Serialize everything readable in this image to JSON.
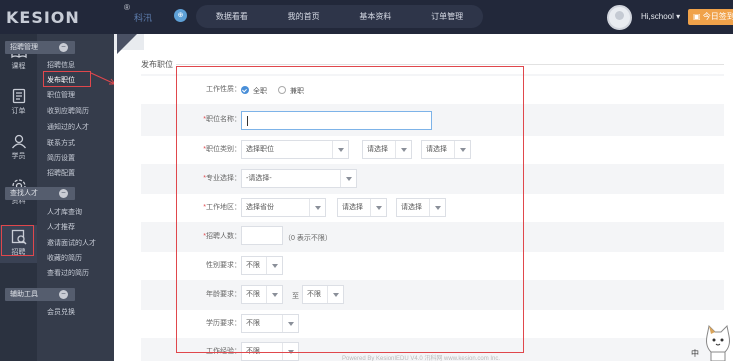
{
  "header": {
    "logo_text": "KESION",
    "logo_reg": "®",
    "logo_sub": "科汛",
    "circle_icon": "⊕",
    "nav": [
      "数据看看",
      "我的首页",
      "基本资料",
      "订单管理"
    ],
    "username": "Hi,school",
    "today_button": "今日签到"
  },
  "rail": [
    {
      "label": "课程",
      "icon": "book-icon"
    },
    {
      "label": "订单",
      "icon": "order-icon"
    },
    {
      "label": "学员",
      "icon": "user-icon"
    },
    {
      "label": "资料",
      "icon": "gear-icon"
    },
    {
      "label": "招聘",
      "icon": "recruit-icon"
    }
  ],
  "submenu": {
    "group1": {
      "title": "招聘管理",
      "items": [
        "招聘信息",
        "发布职位",
        "职位管理",
        "收到应聘简历",
        "通知过的人才",
        "联系方式",
        "简历设置",
        "招聘配置"
      ]
    },
    "group2": {
      "title": "查找人才",
      "items": [
        "人才库查询",
        "人才推荐",
        "邀请面试的人才",
        "收藏的简历",
        "查看过的简历"
      ]
    },
    "group3": {
      "title": "辅助工具",
      "items": [
        "会员兑换"
      ]
    }
  },
  "page": {
    "title": "发布职位",
    "footer": "Powered By KesionIEDU V4.0 汛科网 www.kesion.com Inc."
  },
  "form": {
    "work_type": {
      "label": "工作性质：",
      "options": [
        "全职",
        "兼职"
      ],
      "selected": "全职"
    },
    "job_name": {
      "label": "职位名称：",
      "req": "*",
      "value": ""
    },
    "job_category": {
      "label": "职位类别：",
      "req": "*",
      "values": [
        "选择职位",
        "请选择",
        "请选择"
      ]
    },
    "major": {
      "label": "专业选择：",
      "req": "*",
      "value": "-请选择-"
    },
    "work_area": {
      "label": "工作地区：",
      "req": "*",
      "values": [
        "选择省份",
        "请选择",
        "请选择"
      ]
    },
    "headcount": {
      "label": "招聘人数：",
      "req": "*",
      "value": "",
      "hint": "（0 表示不限）"
    },
    "gender": {
      "label": "性别要求：",
      "value": "不限"
    },
    "age": {
      "label": "年龄要求：",
      "from": "不限",
      "sep": "至",
      "to": "不限"
    },
    "education": {
      "label": "学历要求：",
      "value": "不限"
    },
    "experience": {
      "label": "工作经验：",
      "value": "不限"
    }
  },
  "widgets": {
    "lang": "中"
  }
}
